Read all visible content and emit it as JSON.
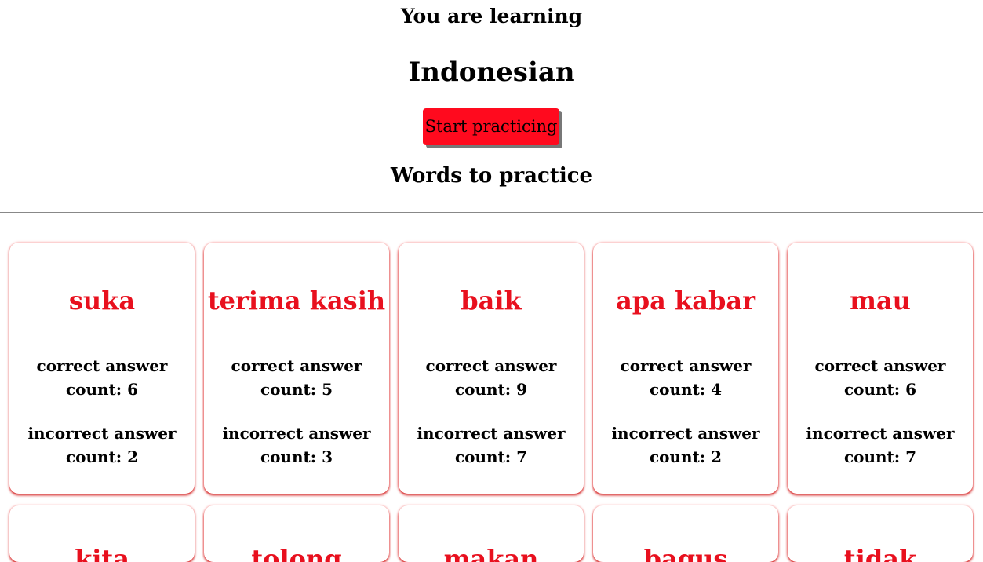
{
  "header": {
    "learning_label": "You are learning",
    "language": "Indonesian",
    "start_button_label": "Start practicing",
    "practice_heading": "Words to practice"
  },
  "colors": {
    "accent_red": "#e8101e",
    "button_red": "#ff0a1e",
    "divider": "#888888",
    "background": "#ffffff"
  },
  "words": [
    {
      "word": "suka",
      "correct": "correct answer count: 6",
      "incorrect": "incorrect answer count: 2"
    },
    {
      "word": "terima kasih",
      "correct": "correct answer count: 5",
      "incorrect": "incorrect answer count: 3"
    },
    {
      "word": "baik",
      "correct": "correct answer count: 9",
      "incorrect": "incorrect answer count: 7"
    },
    {
      "word": "apa kabar",
      "correct": "correct answer count: 4",
      "incorrect": "incorrect answer count: 2"
    },
    {
      "word": "mau",
      "correct": "correct answer count: 6",
      "incorrect": "incorrect answer count: 7"
    },
    {
      "word": "kita",
      "correct": "",
      "incorrect": ""
    },
    {
      "word": "tolong",
      "correct": "",
      "incorrect": ""
    },
    {
      "word": "makan",
      "correct": "",
      "incorrect": ""
    },
    {
      "word": "bagus",
      "correct": "",
      "incorrect": ""
    },
    {
      "word": "tidak",
      "correct": "",
      "incorrect": ""
    }
  ]
}
